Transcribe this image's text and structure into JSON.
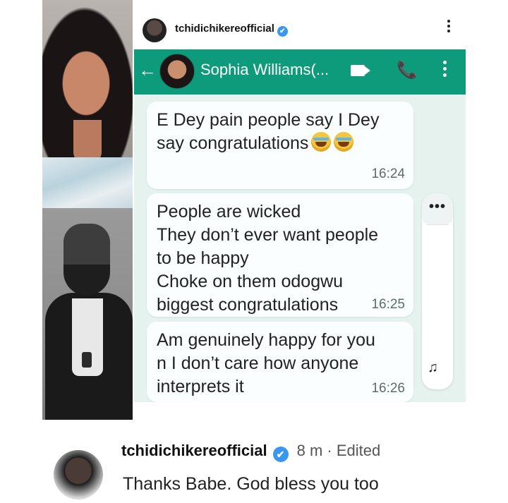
{
  "post": {
    "username": "tchidichikereofficial",
    "verified_glyph": "✔"
  },
  "chat": {
    "back_icon": "←",
    "contact_name": "Sophia Williams(...",
    "phone_icon": "📞",
    "messages": [
      {
        "text": "E Dey pain people say I Dey\nsay congratulations",
        "time": "16:24"
      },
      {
        "text": "People are wicked\nThey don’t ever want people\nto be happy\nChoke on them odogwu\nbiggest congratulations",
        "time": "16:25"
      },
      {
        "text": "Am genuinely happy for you\nn I don’t care how anyone\ninterprets it",
        "time": "16:26"
      }
    ],
    "side_menu_dots": "•••",
    "voice_icon": "♫"
  },
  "comment": {
    "username": "tchidichikereofficial",
    "verified_glyph": "✔",
    "meta": "8 m · Edited",
    "text": "Thanks Babe. God bless you too"
  },
  "colors": {
    "chat_bar": "#0d9b7b",
    "chat_bg": "#e6f2ee",
    "verified_badge": "#3897f0"
  },
  "icons": [
    "back-arrow-icon",
    "video-call-icon",
    "phone-icon",
    "more-vert-icon",
    "laughing-tears-emoji",
    "voice-message-icon",
    "verified-badge-icon"
  ]
}
